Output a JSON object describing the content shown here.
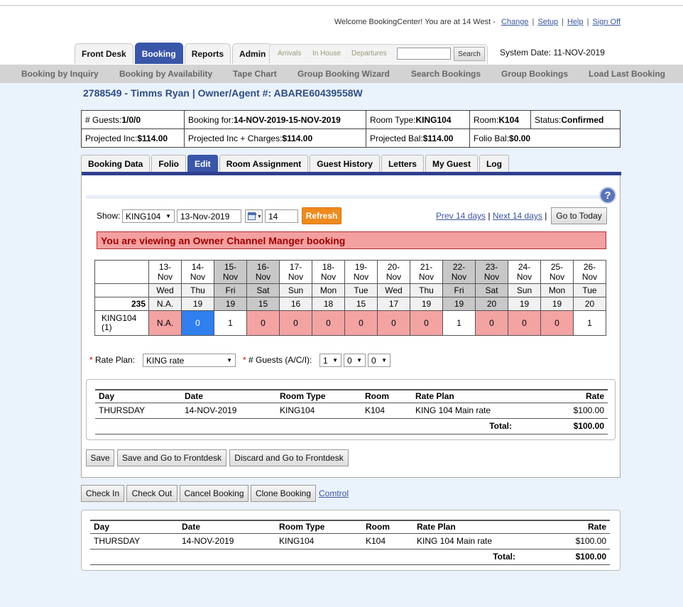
{
  "header": {
    "welcome_text": "Welcome BookingCenter! You are at 14 West -",
    "links": [
      "Change",
      "Setup",
      "Help",
      "Sign Off"
    ],
    "system_date": "System Date: 11-NOV-2019"
  },
  "main_tabs": [
    {
      "label": "Front Desk",
      "active": false
    },
    {
      "label": "Booking",
      "active": true
    },
    {
      "label": "Reports",
      "active": false
    },
    {
      "label": "Admin",
      "active": false
    }
  ],
  "quick_search": {
    "links": [
      "Arrivals",
      "In House",
      "Departures"
    ],
    "value": "",
    "button": "Search"
  },
  "subnav": [
    "Booking by Inquiry",
    "Booking by Availability",
    "Tape Chart",
    "Group Booking Wizard",
    "Search Bookings",
    "Group Bookings",
    "Load Last Booking"
  ],
  "booking_title": "2788549 - Timms Ryan | Owner/Agent #: ABARE60439558W",
  "info": {
    "guests_label": "# Guests:",
    "guests": "1/0/0",
    "booking_for_label": "Booking for:",
    "booking_for": "14-NOV-2019-15-NOV-2019",
    "room_type_label": "Room Type:",
    "room_type": "KING104",
    "room_label": "Room:",
    "room": "K104",
    "status_label": "Status:",
    "status": "Confirmed",
    "proj_inc_label": "Projected Inc:",
    "proj_inc": "$114.00",
    "proj_inc_charges_label": "Projected Inc + Charges:",
    "proj_inc_charges": "$114.00",
    "proj_bal_label": "Projected Bal:",
    "proj_bal": "$114.00",
    "folio_bal_label": "Folio Bal:",
    "folio_bal": "$0.00"
  },
  "sub_tabs": [
    {
      "label": "Booking Data",
      "active": false
    },
    {
      "label": "Folio",
      "active": false
    },
    {
      "label": "Edit",
      "active": true
    },
    {
      "label": "Room Assignment",
      "active": false
    },
    {
      "label": "Guest History",
      "active": false
    },
    {
      "label": "Letters",
      "active": false
    },
    {
      "label": "My Guest",
      "active": false
    },
    {
      "label": "Log",
      "active": false
    }
  ],
  "controls": {
    "show_label": "Show:",
    "room_select": "KING104",
    "date_value": "13-Nov-2019",
    "days_value": "14",
    "refresh": "Refresh",
    "prev": "Prev 14 days",
    "next": "Next 14 days",
    "today": "Go to Today"
  },
  "alert": "You are viewing an Owner Channel Manger booking",
  "calendar": {
    "total": "235",
    "room_label": "KING104",
    "room_count": "(1)",
    "days": [
      {
        "d": "13-",
        "m": "Nov",
        "dow": "Wed",
        "cnt": "N.A.",
        "val": "N.A.",
        "weekend": false,
        "cell": "pink"
      },
      {
        "d": "14-",
        "m": "Nov",
        "dow": "Thu",
        "cnt": "19",
        "val": "0",
        "weekend": false,
        "cell": "blue"
      },
      {
        "d": "15-",
        "m": "Nov",
        "dow": "Fri",
        "cnt": "19",
        "val": "1",
        "weekend": true,
        "cell": "white"
      },
      {
        "d": "16-",
        "m": "Nov",
        "dow": "Sat",
        "cnt": "15",
        "val": "0",
        "weekend": true,
        "cell": "pink"
      },
      {
        "d": "17-",
        "m": "Nov",
        "dow": "Sun",
        "cnt": "16",
        "val": "0",
        "weekend": false,
        "cell": "pink"
      },
      {
        "d": "18-",
        "m": "Nov",
        "dow": "Mon",
        "cnt": "18",
        "val": "0",
        "weekend": false,
        "cell": "pink"
      },
      {
        "d": "19-",
        "m": "Nov",
        "dow": "Tue",
        "cnt": "15",
        "val": "0",
        "weekend": false,
        "cell": "pink"
      },
      {
        "d": "20-",
        "m": "Nov",
        "dow": "Wed",
        "cnt": "17",
        "val": "0",
        "weekend": false,
        "cell": "pink"
      },
      {
        "d": "21-",
        "m": "Nov",
        "dow": "Thu",
        "cnt": "19",
        "val": "0",
        "weekend": false,
        "cell": "pink"
      },
      {
        "d": "22-",
        "m": "Nov",
        "dow": "Fri",
        "cnt": "19",
        "val": "1",
        "weekend": true,
        "cell": "white"
      },
      {
        "d": "23-",
        "m": "Nov",
        "dow": "Sat",
        "cnt": "20",
        "val": "0",
        "weekend": true,
        "cell": "pink"
      },
      {
        "d": "24-",
        "m": "Nov",
        "dow": "Sun",
        "cnt": "19",
        "val": "0",
        "weekend": false,
        "cell": "pink"
      },
      {
        "d": "25-",
        "m": "Nov",
        "dow": "Mon",
        "cnt": "19",
        "val": "0",
        "weekend": false,
        "cell": "pink"
      },
      {
        "d": "26-",
        "m": "Nov",
        "dow": "Tue",
        "cnt": "20",
        "val": "1",
        "weekend": false,
        "cell": "white"
      }
    ]
  },
  "rate_plan": {
    "label": "Rate Plan:",
    "value": "KING rate",
    "guests_label": "# Guests (A/C/I):",
    "adults": "1",
    "children": "0",
    "infants": "0"
  },
  "rate_table": {
    "headers": [
      "Day",
      "Date",
      "Room Type",
      "Room",
      "Rate Plan",
      "Rate"
    ],
    "rows": [
      [
        "THURSDAY",
        "14-NOV-2019",
        "KING104",
        "K104",
        "KING 104 Main rate",
        "$100.00"
      ]
    ],
    "total_label": "Total:",
    "total": "$100.00"
  },
  "edit_buttons": [
    "Save",
    "Save and Go to Frontdesk",
    "Discard and Go to Frontdesk"
  ],
  "action_buttons": [
    "Check In",
    "Check Out",
    "Cancel Booking",
    "Clone Booking"
  ],
  "control_link": "Comtrol",
  "colors": {
    "accent": "#3a56a8",
    "alert_bg": "#f4a0a0",
    "refresh": "#ef8a1e",
    "available": "#2f7fef",
    "unavailable": "#f4a3a3"
  }
}
